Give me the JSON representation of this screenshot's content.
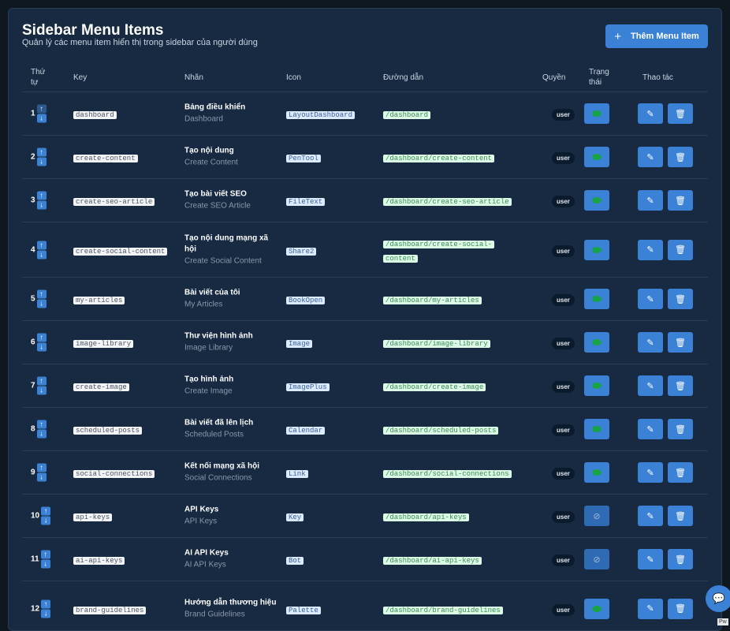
{
  "header": {
    "title": "Sidebar Menu Items",
    "subtitle": "Quản lý các menu item hiển thị trong sidebar của người dùng",
    "add_button_label": "Thêm Menu Item",
    "add_button_icon": "plus-icon"
  },
  "columns": {
    "order": "Thứ tự",
    "key": "Key",
    "label": "Nhãn",
    "icon": "Icon",
    "path": "Đường dẫn",
    "role": "Quyền",
    "status": "Trạng thái",
    "actions": "Thao tác"
  },
  "rows": [
    {
      "order": "1",
      "key": "dashboard",
      "label": "Bảng điều khiển",
      "sublabel": "Dashboard",
      "icon": "LayoutDashboard",
      "path": "/dashboard",
      "role": "user",
      "active": true
    },
    {
      "order": "2",
      "key": "create-content",
      "label": "Tạo nội dung",
      "sublabel": "Create Content",
      "icon": "PenTool",
      "path": "/dashboard/create-content",
      "role": "user",
      "active": true
    },
    {
      "order": "3",
      "key": "create-seo-article",
      "label": "Tạo bài viết SEO",
      "sublabel": "Create SEO Article",
      "icon": "FileText",
      "path": "/dashboard/create-seo-article",
      "role": "user",
      "active": true
    },
    {
      "order": "4",
      "key": "create-social-content",
      "label": "Tạo nội dung mạng xã hội",
      "sublabel": "Create Social Content",
      "icon": "Share2",
      "path": "/dashboard/create-social-content",
      "role": "user",
      "active": true
    },
    {
      "order": "5",
      "key": "my-articles",
      "label": "Bài viết của tôi",
      "sublabel": "My Articles",
      "icon": "BookOpen",
      "path": "/dashboard/my-articles",
      "role": "user",
      "active": true
    },
    {
      "order": "6",
      "key": "image-library",
      "label": "Thư viện hình ảnh",
      "sublabel": "Image Library",
      "icon": "Image",
      "path": "/dashboard/image-library",
      "role": "user",
      "active": true
    },
    {
      "order": "7",
      "key": "create-image",
      "label": "Tạo hình ảnh",
      "sublabel": "Create Image",
      "icon": "ImagePlus",
      "path": "/dashboard/create-image",
      "role": "user",
      "active": true
    },
    {
      "order": "8",
      "key": "scheduled-posts",
      "label": "Bài viết đã lên lịch",
      "sublabel": "Scheduled Posts",
      "icon": "Calendar",
      "path": "/dashboard/scheduled-posts",
      "role": "user",
      "active": true
    },
    {
      "order": "9",
      "key": "social-connections",
      "label": "Kết nối mạng xã hội",
      "sublabel": "Social Connections",
      "icon": "Link",
      "path": "/dashboard/social-connections",
      "role": "user",
      "active": true
    },
    {
      "order": "10",
      "key": "api-keys",
      "label": "API Keys",
      "sublabel": "API Keys",
      "icon": "Key",
      "path": "/dashboard/api-keys",
      "role": "user",
      "active": false
    },
    {
      "order": "11",
      "key": "ai-api-keys",
      "label": "AI API Keys",
      "sublabel": "AI API Keys",
      "icon": "Bot",
      "path": "/dashboard/ai-api-keys",
      "role": "user",
      "active": false
    },
    {
      "order": "12",
      "key": "brand-guidelines",
      "label": "Hướng dẫn thương hiệu",
      "sublabel": "Brand Guidelines",
      "icon": "Palette",
      "path": "/dashboard/brand-guidelines",
      "role": "user",
      "active": true
    }
  ],
  "colors": {
    "accent": "#3b82d6",
    "card_bg": "#172a42",
    "active_eye": "#16a34a"
  },
  "icons": {
    "move_up": "arrow-up-icon",
    "move_down": "arrow-down-icon",
    "visible": "eye-icon",
    "hidden": "eye-off-icon",
    "edit": "edit-icon",
    "delete": "trash-icon",
    "chat": "chat-icon"
  },
  "corner_tag": "Pw"
}
